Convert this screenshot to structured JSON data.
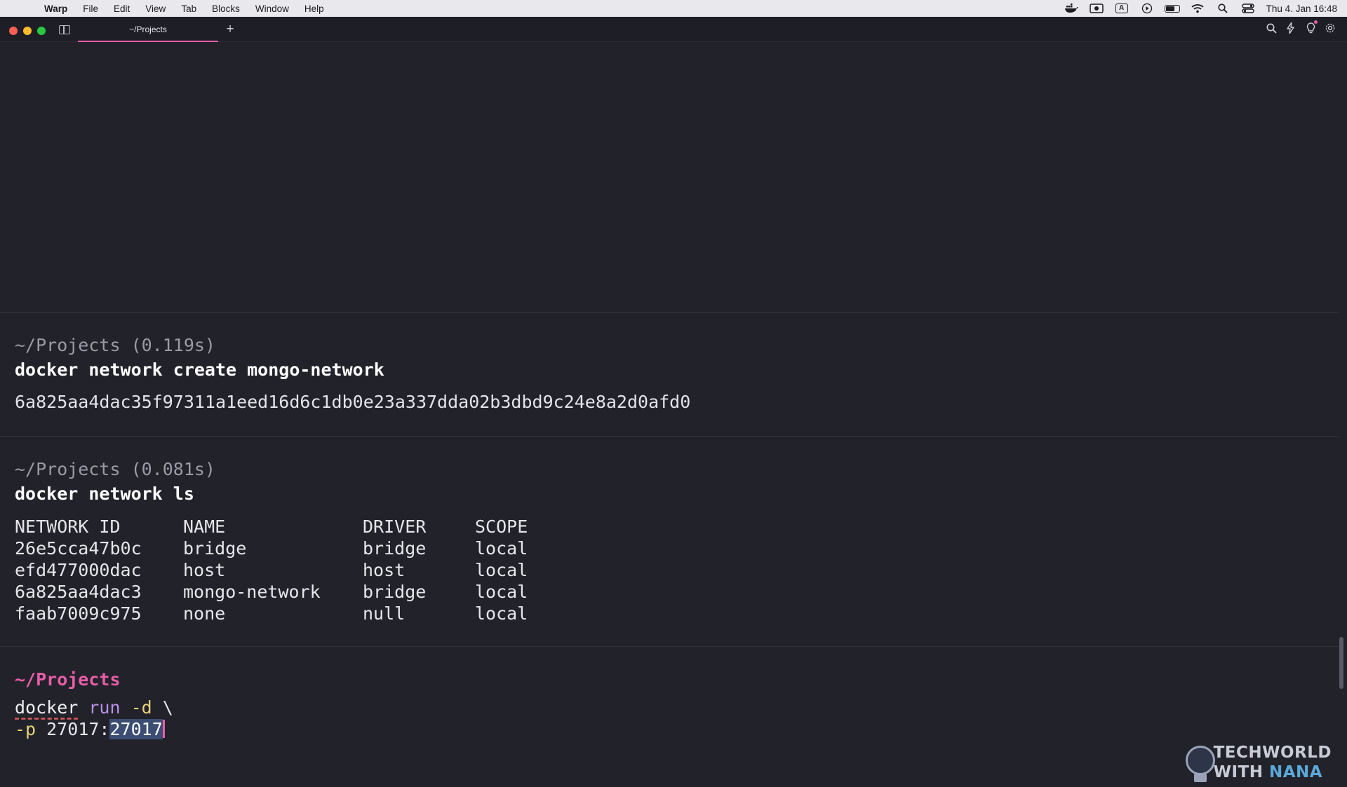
{
  "menubar": {
    "app_name": "Warp",
    "items": [
      "File",
      "Edit",
      "View",
      "Tab",
      "Blocks",
      "Window",
      "Help"
    ],
    "status_icons": [
      "docker-icon",
      "screen-record-icon",
      "keyboard-input-icon",
      "play-icon",
      "battery-icon",
      "wifi-icon",
      "spotlight-search-icon",
      "control-center-icon"
    ],
    "input_source": "A",
    "clock": "Thu 4. Jan  16:48"
  },
  "window": {
    "tab_title": "~/Projects",
    "new_tab_label": "+",
    "toolbar_icons": [
      "search-icon",
      "lightning-icon",
      "lightbulb-icon",
      "settings-icon"
    ]
  },
  "blocks": [
    {
      "meta": "~/Projects (0.119s)",
      "command": "docker network create mongo-network",
      "output": "6a825aa4dac35f97311a1eed16d6c1db0e23a337dda02b3dbd9c24e8a2d0afd0"
    },
    {
      "meta": "~/Projects (0.081s)",
      "command": "docker network ls",
      "table": {
        "headers": [
          "NETWORK ID",
          "NAME",
          "DRIVER",
          "SCOPE"
        ],
        "rows": [
          [
            "26e5cca47b0c",
            "bridge",
            "bridge",
            "local"
          ],
          [
            "efd477000dac",
            "host",
            "host",
            "local"
          ],
          [
            "6a825aa4dac3",
            "mongo-network",
            "bridge",
            "local"
          ],
          [
            "faab7009c975",
            "none",
            "null",
            "local"
          ]
        ]
      }
    }
  ],
  "input": {
    "prompt": "~/Projects",
    "line1": {
      "cmd": "docker",
      "kw": "run",
      "flag": "-d",
      "cont": "\\"
    },
    "line2": {
      "flag": "-p",
      "value_prefix": "27017:",
      "value_selected": "27017"
    }
  },
  "watermark": {
    "line1": "TECHWORLD",
    "line2_a": "WITH ",
    "line2_b": "NANA"
  },
  "colors": {
    "accent": "#e85da8",
    "background": "#22222b"
  }
}
